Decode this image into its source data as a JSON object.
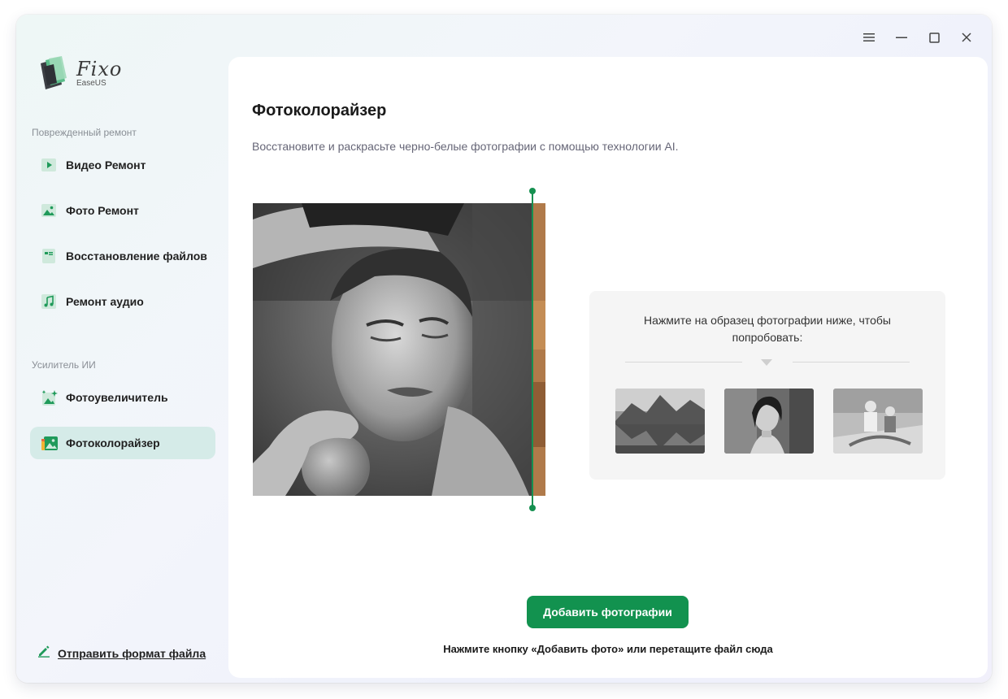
{
  "app": {
    "logo_name": "Fixo",
    "logo_brand": "EaseUS"
  },
  "titlebar": {
    "menu_icon": "menu-icon",
    "minimize_icon": "minimize-icon",
    "maximize_icon": "maximize-icon",
    "close_icon": "close-icon"
  },
  "sidebar": {
    "section_repair": "Поврежденный ремонт",
    "section_ai": "Усилитель ИИ",
    "items": [
      {
        "label": "Видео Ремонт",
        "icon": "video-icon"
      },
      {
        "label": "Фото Ремонт",
        "icon": "photo-icon"
      },
      {
        "label": "Восстановление файлов",
        "icon": "file-icon"
      },
      {
        "label": "Ремонт аудио",
        "icon": "music-icon"
      },
      {
        "label": "Фотоувеличитель",
        "icon": "sparkle-photo-icon"
      },
      {
        "label": "Фотоколорайзер",
        "icon": "colorize-icon",
        "active": true
      }
    ],
    "send_format": "Отправить формат файла"
  },
  "main": {
    "title": "Фотоколорайзер",
    "subtitle": "Восстановите и раскрасьте черно-белые фотографии с помощью технологии AI.",
    "sample_prompt": "Нажмите на образец фотографии ниже, чтобы попробовать:",
    "add_button": "Добавить фотографии",
    "add_hint": "Нажмите кнопку «Добавить фото» или перетащите файл сюда"
  },
  "colors": {
    "accent": "#12924f",
    "active_nav": "#d5ebe8"
  }
}
